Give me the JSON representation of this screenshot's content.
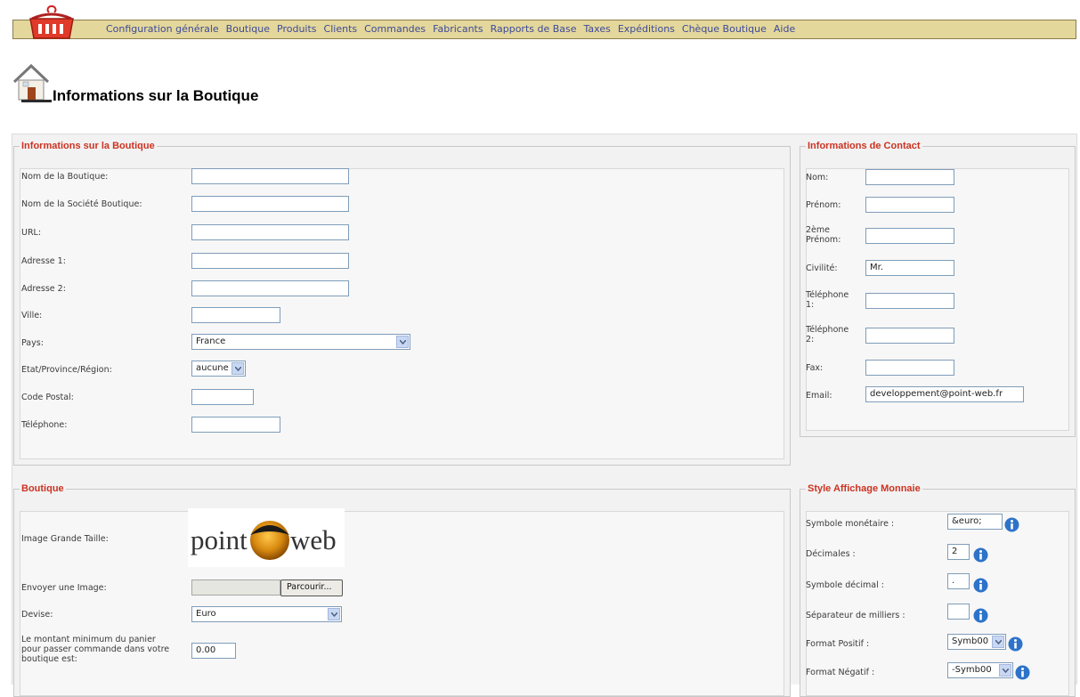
{
  "nav": {
    "items": [
      "Configuration générale",
      "Boutique",
      "Produits",
      "Clients",
      "Commandes",
      "Fabricants",
      "Rapports de Base",
      "Taxes",
      "Expéditions",
      "Chèque Boutique",
      "Aide"
    ]
  },
  "page": {
    "title": "Informations sur la Boutique"
  },
  "shop_info": {
    "legend": "Informations sur la Boutique",
    "fields": {
      "name": {
        "label": "Nom de la Boutique:",
        "value": ""
      },
      "company": {
        "label": "Nom de la Société Boutique:",
        "value": ""
      },
      "url": {
        "label": "URL:",
        "value": ""
      },
      "address1": {
        "label": "Adresse 1:",
        "value": ""
      },
      "address2": {
        "label": "Adresse 2:",
        "value": ""
      },
      "city": {
        "label": "Ville:",
        "value": ""
      },
      "country": {
        "label": "Pays:",
        "value": "France"
      },
      "state": {
        "label": "Etat/Province/Région:",
        "value": "aucune"
      },
      "postcode": {
        "label": "Code Postal:",
        "value": ""
      },
      "phone": {
        "label": "Téléphone:",
        "value": ""
      }
    }
  },
  "contact": {
    "legend": "Informations de Contact",
    "fields": {
      "lastname": {
        "label": "Nom:",
        "value": ""
      },
      "firstname": {
        "label": "Prénom:",
        "value": ""
      },
      "middlename": {
        "label": "2ème Prénom:",
        "value": ""
      },
      "title": {
        "label": "Civilité:",
        "value": "Mr."
      },
      "phone1": {
        "label": "Téléphone 1:",
        "value": ""
      },
      "phone2": {
        "label": "Téléphone 2:",
        "value": ""
      },
      "fax": {
        "label": "Fax:",
        "value": ""
      },
      "email": {
        "label": "Email:",
        "value": "developpement@point-web.fr"
      }
    }
  },
  "boutique": {
    "legend": "Boutique",
    "image_label": "Image Grande Taille:",
    "logo_text_left": "point",
    "logo_text_right": "web",
    "upload_label": "Envoyer une Image:",
    "browse_label": "Parcourir...",
    "currency_label": "Devise:",
    "currency_value": "Euro",
    "min_amount_label": "Le montant minimum du panier pour passer commande dans votre boutique est:",
    "min_amount_value": "0.00"
  },
  "money": {
    "legend": "Style Affichage Monnaie",
    "symbol": {
      "label": "Symbole monétaire :",
      "value": "&euro;"
    },
    "decimals": {
      "label": "Décimales :",
      "value": "2"
    },
    "decimal_symbol": {
      "label": "Symbole décimal :",
      "value": "."
    },
    "thousands": {
      "label": "Séparateur de milliers :",
      "value": ""
    },
    "positive": {
      "label": "Format Positif :",
      "value": "Symb00"
    },
    "negative": {
      "label": "Format Négatif :",
      "value": "-Symb00"
    }
  }
}
